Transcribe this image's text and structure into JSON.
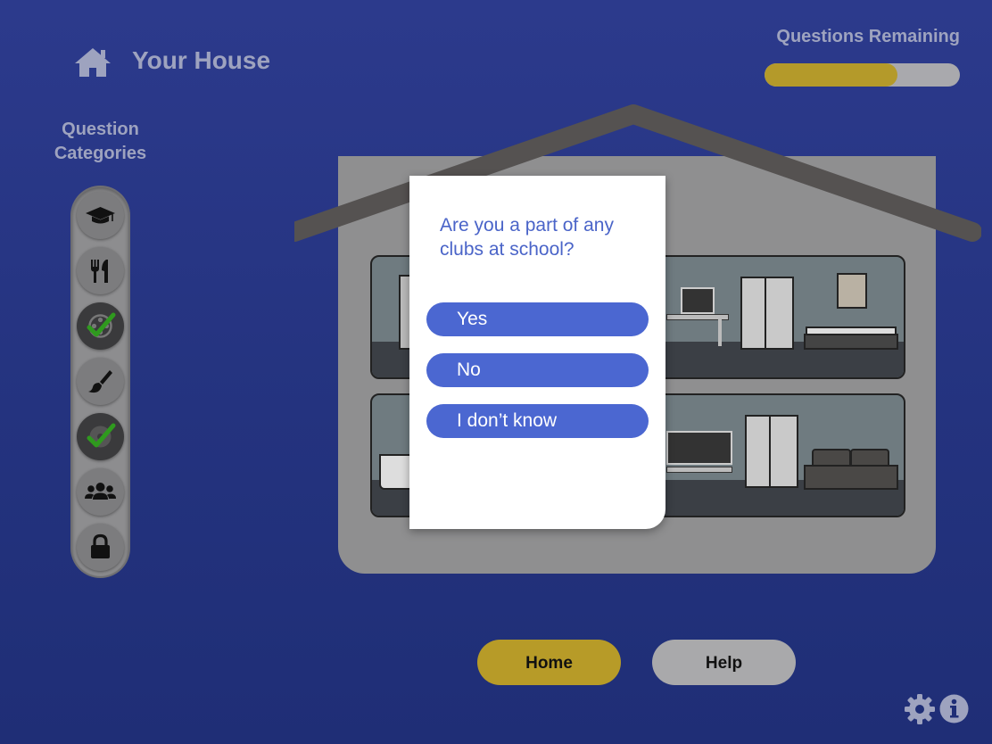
{
  "header": {
    "home_icon": "house-icon",
    "title": "Your House",
    "progress_label": "Questions Remaining",
    "progress_fraction": 0.68
  },
  "categories": {
    "title_line1": "Question",
    "title_line2": "Categories",
    "items": [
      {
        "icon": "graduation-cap-icon",
        "completed": false
      },
      {
        "icon": "utensils-icon",
        "completed": false
      },
      {
        "icon": "film-reel-icon",
        "completed": true
      },
      {
        "icon": "paintbrush-icon",
        "completed": false
      },
      {
        "icon": "disc-icon",
        "completed": true
      },
      {
        "icon": "users-icon",
        "completed": false
      },
      {
        "icon": "lock-icon",
        "completed": false
      }
    ]
  },
  "question_card": {
    "question": "Are you a part of any clubs at school?",
    "answers": [
      "Yes",
      "No",
      "I don’t know"
    ]
  },
  "footer": {
    "home_label": "Home",
    "help_label": "Help",
    "settings_icon": "gear-icon",
    "info_icon": "info-icon"
  },
  "colors": {
    "background": "#24337f",
    "accent_gold": "#b79b28",
    "answer_blue": "#4b67d1",
    "check_green": "#2f9a1e"
  }
}
